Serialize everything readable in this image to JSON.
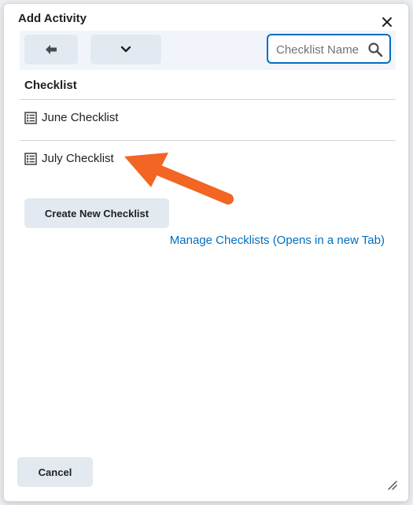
{
  "dialog": {
    "title": "Add Activity",
    "close_icon": "close-icon"
  },
  "toolbar": {
    "back_icon": "arrow-left-icon",
    "dropdown_icon": "chevron-down-icon",
    "search_placeholder": "Checklist Name",
    "search_value": "",
    "search_icon": "search-icon"
  },
  "list": {
    "header": "Checklist",
    "items": [
      {
        "label": "June Checklist",
        "icon": "checklist-icon"
      },
      {
        "label": "July Checklist",
        "icon": "checklist-icon"
      }
    ]
  },
  "actions": {
    "create_label": "Create New Checklist",
    "manage_link": "Manage Checklists (Opens in a new Tab)",
    "cancel_label": "Cancel"
  },
  "colors": {
    "accent": "#006fbf",
    "annotation_arrow": "#f26522"
  }
}
